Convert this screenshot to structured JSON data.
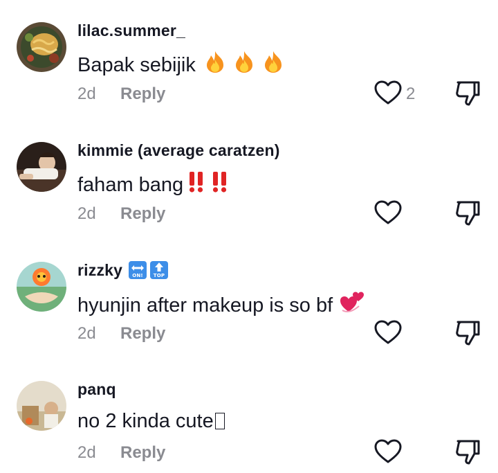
{
  "comments": [
    {
      "username": "lilac.summer_",
      "text": "Bapak sebijik",
      "emojis": [
        "fire",
        "fire",
        "fire"
      ],
      "time": "2d",
      "reply_label": "Reply",
      "like_count": "2"
    },
    {
      "username": "kimmie (average caratzen)",
      "text": "faham bang",
      "emojis": [
        "double-exclamation",
        "double-exclamation"
      ],
      "time": "2d",
      "reply_label": "Reply",
      "like_count": ""
    },
    {
      "username": "rizzky",
      "username_badges": [
        "ON!",
        "TOP"
      ],
      "text": "hyunjin after makeup is so bf",
      "emojis": [
        "revolving-hearts"
      ],
      "time": "2d",
      "reply_label": "Reply",
      "like_count": ""
    },
    {
      "username": "panq",
      "text": "no 2 kinda cute",
      "emojis": [
        "missing-glyph"
      ],
      "time": "2d",
      "reply_label": "Reply",
      "like_count": ""
    }
  ],
  "colors": {
    "primary_text": "#161823",
    "secondary_text": "#8a8b91",
    "icon_stroke": "#161823",
    "badge_blue": "#3d8ee8"
  },
  "icons": {
    "like": "heart-outline-icon",
    "dislike": "thumbs-down-icon"
  }
}
